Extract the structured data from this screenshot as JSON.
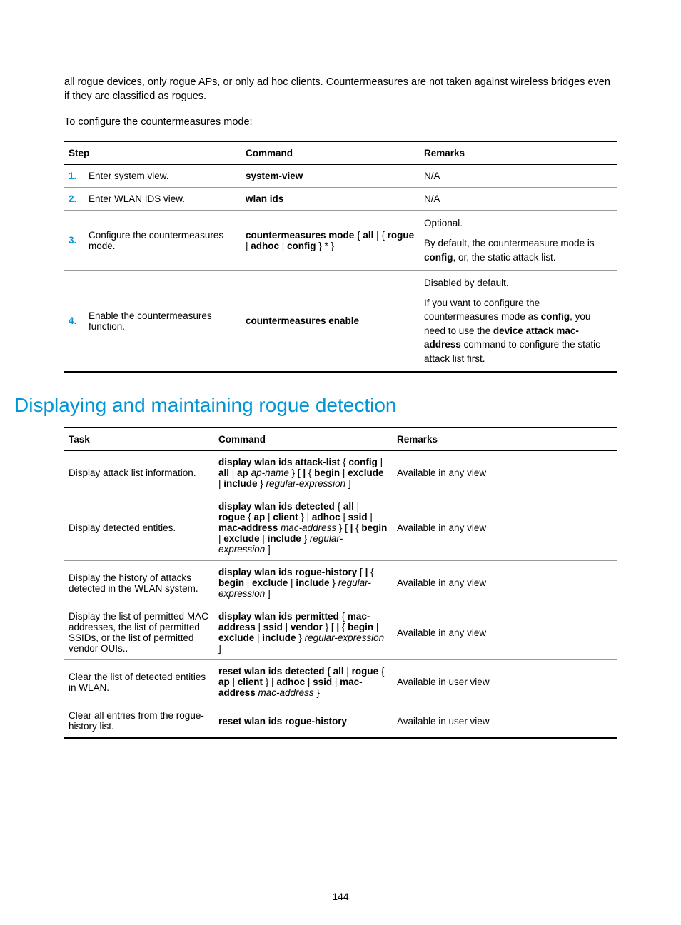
{
  "intro_text": "all rogue devices, only rogue APs, or only ad hoc clients. Countermeasures are not taken against wireless bridges even if they are classified as rogues.",
  "config_lead": "To configure the countermeasures mode:",
  "table1": {
    "headers": {
      "step": "Step",
      "command": "Command",
      "remarks": "Remarks"
    },
    "rows": [
      {
        "num": "1.",
        "step": "Enter system view.",
        "command_parts": [
          {
            "t": "system-view",
            "b": true
          }
        ],
        "remarks_parts": [
          {
            "t": "N/A"
          }
        ]
      },
      {
        "num": "2.",
        "step": "Enter WLAN IDS view.",
        "command_parts": [
          {
            "t": "wlan ids",
            "b": true
          }
        ],
        "remarks_parts": [
          {
            "t": "N/A"
          }
        ]
      },
      {
        "num": "3.",
        "step": "Configure the countermeasures mode.",
        "command_parts": [
          {
            "t": "countermeasures mode",
            "b": true
          },
          {
            "t": " { "
          },
          {
            "t": "all",
            "b": true
          },
          {
            "t": " | { "
          },
          {
            "t": "rogue",
            "b": true
          },
          {
            "t": " | "
          },
          {
            "t": "adhoc",
            "b": true
          },
          {
            "t": " | "
          },
          {
            "t": "config",
            "b": true
          },
          {
            "t": " } * }"
          }
        ],
        "remarks_blocks": [
          [
            {
              "t": "Optional."
            }
          ],
          [
            {
              "t": "By default, the countermeasure mode is "
            },
            {
              "t": "config",
              "b": true
            },
            {
              "t": ", or, the static attack list."
            }
          ]
        ]
      },
      {
        "num": "4.",
        "step": "Enable the countermeasures function.",
        "command_parts": [
          {
            "t": "countermeasures enable",
            "b": true
          }
        ],
        "remarks_blocks": [
          [
            {
              "t": "Disabled by default."
            }
          ],
          [
            {
              "t": "If you want to configure the countermeasures mode as "
            },
            {
              "t": "config",
              "b": true
            },
            {
              "t": ", you need to use the "
            },
            {
              "t": "device attack mac-address",
              "b": true
            },
            {
              "t": " command to configure the static attack list first."
            }
          ]
        ]
      }
    ]
  },
  "section_heading": "Displaying and maintaining rogue detection",
  "table2": {
    "headers": {
      "task": "Task",
      "command": "Command",
      "remarks": "Remarks"
    },
    "rows": [
      {
        "task": "Display attack list information.",
        "command_parts": [
          {
            "t": "display wlan ids attack-list",
            "b": true
          },
          {
            "t": " { "
          },
          {
            "t": "config",
            "b": true
          },
          {
            "t": " | "
          },
          {
            "t": "all",
            "b": true
          },
          {
            "t": " | "
          },
          {
            "t": "ap",
            "b": true
          },
          {
            "t": " "
          },
          {
            "t": "ap-name",
            "i": true
          },
          {
            "t": " } [ "
          },
          {
            "t": "|",
            "b": true
          },
          {
            "t": " { "
          },
          {
            "t": "begin",
            "b": true
          },
          {
            "t": " | "
          },
          {
            "t": "exclude",
            "b": true
          },
          {
            "t": " | "
          },
          {
            "t": "include",
            "b": true
          },
          {
            "t": " } "
          },
          {
            "t": "regular-expression",
            "i": true
          },
          {
            "t": " ]"
          }
        ],
        "remarks": "Available in any view"
      },
      {
        "task": "Display detected entities.",
        "command_parts": [
          {
            "t": "display wlan ids detected",
            "b": true
          },
          {
            "t": " { "
          },
          {
            "t": "all",
            "b": true
          },
          {
            "t": " | "
          },
          {
            "t": "rogue",
            "b": true
          },
          {
            "t": " { "
          },
          {
            "t": "ap",
            "b": true
          },
          {
            "t": " | "
          },
          {
            "t": "client",
            "b": true
          },
          {
            "t": " } | "
          },
          {
            "t": "adhoc",
            "b": true
          },
          {
            "t": " | "
          },
          {
            "t": "ssid",
            "b": true
          },
          {
            "t": " | "
          },
          {
            "t": "mac-address",
            "b": true
          },
          {
            "t": " "
          },
          {
            "t": "mac-address",
            "i": true
          },
          {
            "t": " } [ "
          },
          {
            "t": "|",
            "b": true
          },
          {
            "t": " { "
          },
          {
            "t": "begin",
            "b": true
          },
          {
            "t": " | "
          },
          {
            "t": "exclude",
            "b": true
          },
          {
            "t": " | "
          },
          {
            "t": "include",
            "b": true
          },
          {
            "t": " } "
          },
          {
            "t": "regular-expression",
            "i": true
          },
          {
            "t": " ]"
          }
        ],
        "remarks": "Available in any view"
      },
      {
        "task": "Display the history of attacks detected in the WLAN system.",
        "command_parts": [
          {
            "t": "display wlan ids rogue-history",
            "b": true
          },
          {
            "t": " [ "
          },
          {
            "t": "|",
            "b": true
          },
          {
            "t": " { "
          },
          {
            "t": "begin",
            "b": true
          },
          {
            "t": " | "
          },
          {
            "t": "exclude",
            "b": true
          },
          {
            "t": " | "
          },
          {
            "t": "include",
            "b": true
          },
          {
            "t": " } "
          },
          {
            "t": "regular-expression",
            "i": true
          },
          {
            "t": " ]"
          }
        ],
        "remarks": "Available in any view"
      },
      {
        "task": "Display the list of permitted MAC addresses, the list of permitted SSIDs, or the list of permitted vendor OUIs..",
        "command_parts": [
          {
            "t": "display wlan ids permitted",
            "b": true
          },
          {
            "t": " { "
          },
          {
            "t": "mac-address",
            "b": true
          },
          {
            "t": " | "
          },
          {
            "t": "ssid",
            "b": true
          },
          {
            "t": " | "
          },
          {
            "t": "vendor",
            "b": true
          },
          {
            "t": " } [ "
          },
          {
            "t": "|",
            "b": true
          },
          {
            "t": " { "
          },
          {
            "t": "begin",
            "b": true
          },
          {
            "t": " | "
          },
          {
            "t": "exclude",
            "b": true
          },
          {
            "t": " | "
          },
          {
            "t": "include",
            "b": true
          },
          {
            "t": " } "
          },
          {
            "t": "regular-expression",
            "i": true
          },
          {
            "t": " ]"
          }
        ],
        "remarks": "Available in any view"
      },
      {
        "task": "Clear the list of detected entities in WLAN.",
        "command_parts": [
          {
            "t": "reset wlan ids detected",
            "b": true
          },
          {
            "t": " { "
          },
          {
            "t": "all",
            "b": true
          },
          {
            "t": " | "
          },
          {
            "t": "rogue",
            "b": true
          },
          {
            "t": " { "
          },
          {
            "t": "ap",
            "b": true
          },
          {
            "t": " | "
          },
          {
            "t": "client",
            "b": true
          },
          {
            "t": " } | "
          },
          {
            "t": "adhoc",
            "b": true
          },
          {
            "t": " | "
          },
          {
            "t": "ssid",
            "b": true
          },
          {
            "t": " | "
          },
          {
            "t": "mac-address",
            "b": true
          },
          {
            "t": " "
          },
          {
            "t": "mac-address",
            "i": true
          },
          {
            "t": " }"
          }
        ],
        "remarks": "Available in user view"
      },
      {
        "task": "Clear all entries from the rogue-history list.",
        "command_parts": [
          {
            "t": "reset wlan ids rogue-history",
            "b": true
          }
        ],
        "remarks": "Available in user view"
      }
    ]
  },
  "page_number": "144"
}
